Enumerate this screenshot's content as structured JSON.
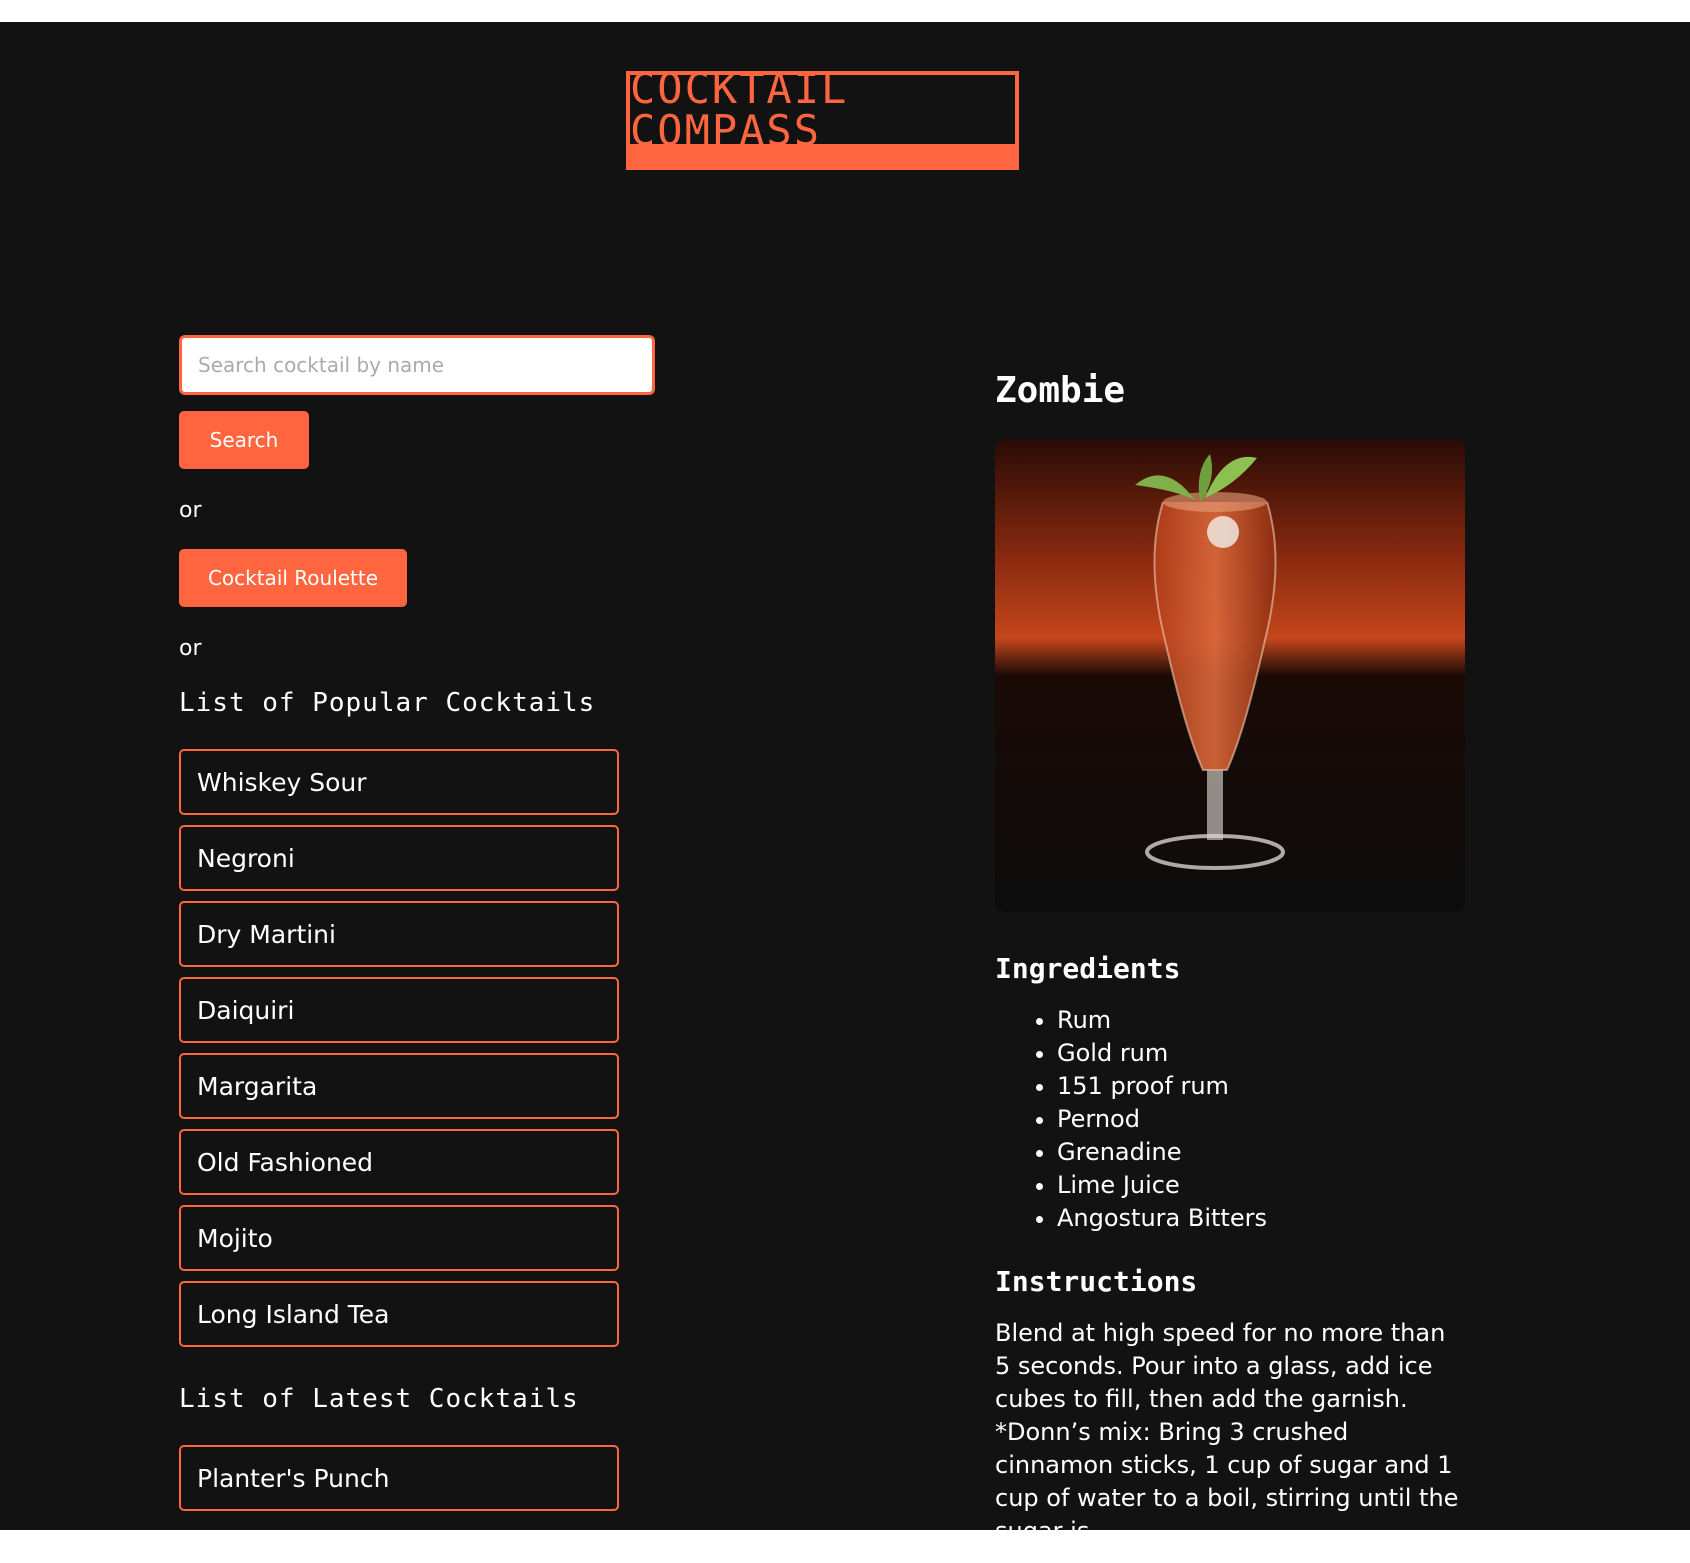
{
  "brand": {
    "title": "Cocktail Compass",
    "color": "#ff6640"
  },
  "search": {
    "placeholder": "Search cocktail by name",
    "button_label": "Search"
  },
  "or_label": "or",
  "roulette": {
    "button_label": "Cocktail Roulette"
  },
  "popular": {
    "title": "List of Popular Cocktails",
    "items": [
      "Whiskey Sour",
      "Negroni",
      "Dry Martini",
      "Daiquiri",
      "Margarita",
      "Old Fashioned",
      "Mojito",
      "Long Island Tea"
    ]
  },
  "latest": {
    "title": "List of Latest Cocktails",
    "items": [
      "Planter's Punch"
    ]
  },
  "detail": {
    "name": "Zombie",
    "image_icon": "cocktail-photo",
    "ingredients_title": "Ingredients",
    "ingredients": [
      "Rum",
      "Gold rum",
      "151 proof rum",
      "Pernod",
      "Grenadine",
      "Lime Juice",
      "Angostura Bitters"
    ],
    "instructions_title": "Instructions",
    "instructions": "Blend at high speed for no more than 5 seconds. Pour into a glass, add ice cubes to fill, then add the garnish. *Donn’s mix: Bring 3 crushed cinnamon sticks, 1 cup of sugar and 1 cup of water to a boil, stirring until the sugar is"
  }
}
